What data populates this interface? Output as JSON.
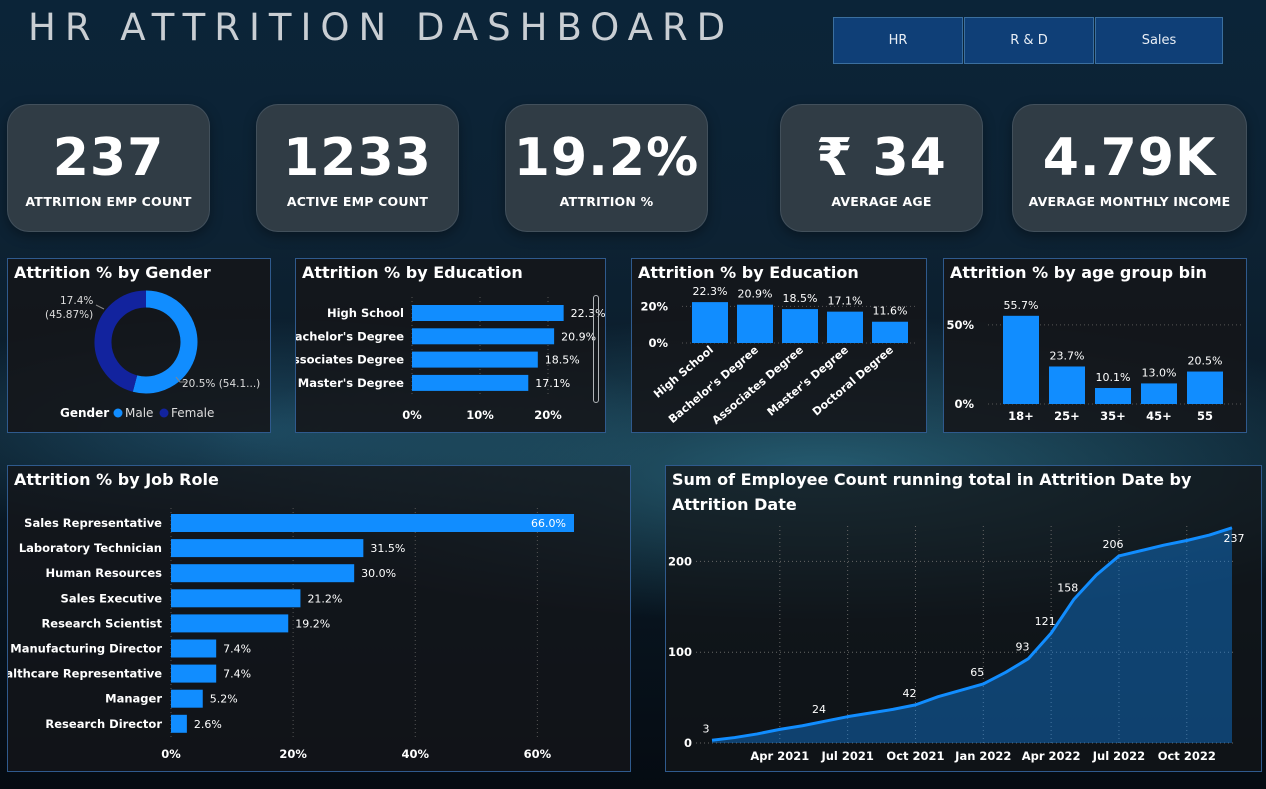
{
  "title": "HR ATTRITION  DASHBOARD",
  "slicer": {
    "options": [
      "HR",
      "R & D",
      "Sales"
    ]
  },
  "kpis": [
    {
      "value": "237",
      "label": "ATTRITION EMP COUNT"
    },
    {
      "value": "1233",
      "label": "ACTIVE EMP COUNT"
    },
    {
      "value": "19.2%",
      "label": "ATTRITION %"
    },
    {
      "value": "₹ 34",
      "label": "AVERAGE AGE"
    },
    {
      "value": "4.79K",
      "label": "AVERAGE MONTHLY INCOME"
    }
  ],
  "colors": {
    "accent": "#118dff",
    "dark": "#12239e",
    "panel_border": "#2f5a8d",
    "slicer": "#0f3f77"
  },
  "chart_data": [
    {
      "id": "gender",
      "type": "pie",
      "title": "Attrition % by Gender",
      "legend_title": "Gender",
      "legend_placement": "bottom",
      "slices": [
        {
          "name": "Male",
          "value": 54.13,
          "label": "20.5% (54.1...)",
          "color": "#118dff"
        },
        {
          "name": "Female",
          "value": 45.87,
          "label": "17.4%\n(45.87%)",
          "color": "#12239e"
        }
      ]
    },
    {
      "id": "edu_h",
      "type": "bar",
      "orientation": "horizontal",
      "title": "Attrition % by Education",
      "categories": [
        "High School",
        "Bachelor's Degree",
        "Associates Degree",
        "Master's Degree"
      ],
      "values": [
        22.3,
        20.9,
        18.5,
        17.1
      ],
      "labels": [
        "22.3%",
        "20.9%",
        "18.5%",
        "17.1%"
      ],
      "xticks": [
        "0%",
        "10%",
        "20%"
      ],
      "xlim": [
        0,
        25
      ]
    },
    {
      "id": "edu_v",
      "type": "bar",
      "orientation": "vertical",
      "title": "Attrition % by Education",
      "categories": [
        "High School",
        "Bachelor's Degree",
        "Associates Degree",
        "Master's Degree",
        "Doctoral Degree"
      ],
      "values": [
        22.3,
        20.9,
        18.5,
        17.1,
        11.6
      ],
      "labels": [
        "22.3%",
        "20.9%",
        "18.5%",
        "17.1%",
        "11.6%"
      ],
      "yticks": [
        "20%",
        "0%"
      ],
      "ylim": [
        0,
        24
      ]
    },
    {
      "id": "age",
      "type": "bar",
      "orientation": "vertical",
      "title": "Attrition % by age group bin",
      "categories": [
        "18+",
        "25+",
        "35+",
        "45+",
        "55"
      ],
      "values": [
        55.7,
        23.7,
        10.1,
        13.0,
        20.5
      ],
      "labels": [
        "55.7%",
        "23.7%",
        "10.1%",
        "13.0%",
        "20.5%"
      ],
      "yticks": [
        "50%",
        "0%"
      ],
      "ylim": [
        0,
        60
      ]
    },
    {
      "id": "jobrole",
      "type": "bar",
      "orientation": "horizontal",
      "title": "Attrition % by Job Role",
      "categories": [
        "Sales Representative",
        "Laboratory Technician",
        "Human Resources",
        "Sales Executive",
        "Research Scientist",
        "Manufacturing Director",
        "Healthcare Representative",
        "Manager",
        "Research Director"
      ],
      "values": [
        66.0,
        31.5,
        30.0,
        21.2,
        19.2,
        7.4,
        7.4,
        5.2,
        2.6
      ],
      "labels": [
        "66.0%",
        "31.5%",
        "30.0%",
        "21.2%",
        "19.2%",
        "7.4%",
        "7.4%",
        "5.2%",
        "2.6%"
      ],
      "xticks": [
        "0%",
        "20%",
        "40%",
        "60%"
      ],
      "xlim": [
        0,
        66
      ]
    },
    {
      "id": "running",
      "type": "area",
      "title": "Sum of Employee Count running total in Attrition Date by Attrition Date",
      "x": [
        "2021-01",
        "2021-02",
        "2021-03",
        "2021-04",
        "2021-05",
        "2021-06",
        "2021-07",
        "2021-08",
        "2021-09",
        "2021-10",
        "2021-11",
        "2021-12",
        "2022-01",
        "2022-02",
        "2022-03",
        "2022-04",
        "2022-05",
        "2022-06",
        "2022-07",
        "2022-08",
        "2022-09",
        "2022-10",
        "2022-11",
        "2022-12"
      ],
      "values": [
        3,
        6,
        10,
        15,
        19,
        24,
        29,
        33,
        37,
        42,
        51,
        58,
        65,
        78,
        93,
        121,
        158,
        185,
        206,
        212,
        218,
        223,
        229,
        237
      ],
      "point_labels": [
        "3",
        "",
        "",
        "",
        "",
        "24",
        "",
        "",
        "",
        "42",
        "",
        "",
        "65",
        "",
        "93",
        "121",
        "158",
        "",
        "206",
        "",
        "",
        "",
        "",
        "237"
      ],
      "xticks": [
        "Apr 2021",
        "Jul 2021",
        "Oct 2021",
        "Jan 2022",
        "Apr 2022",
        "Jul 2022",
        "Oct 2022"
      ],
      "yticks": [
        "0",
        "100",
        "200"
      ],
      "ylim": [
        0,
        250
      ]
    }
  ]
}
